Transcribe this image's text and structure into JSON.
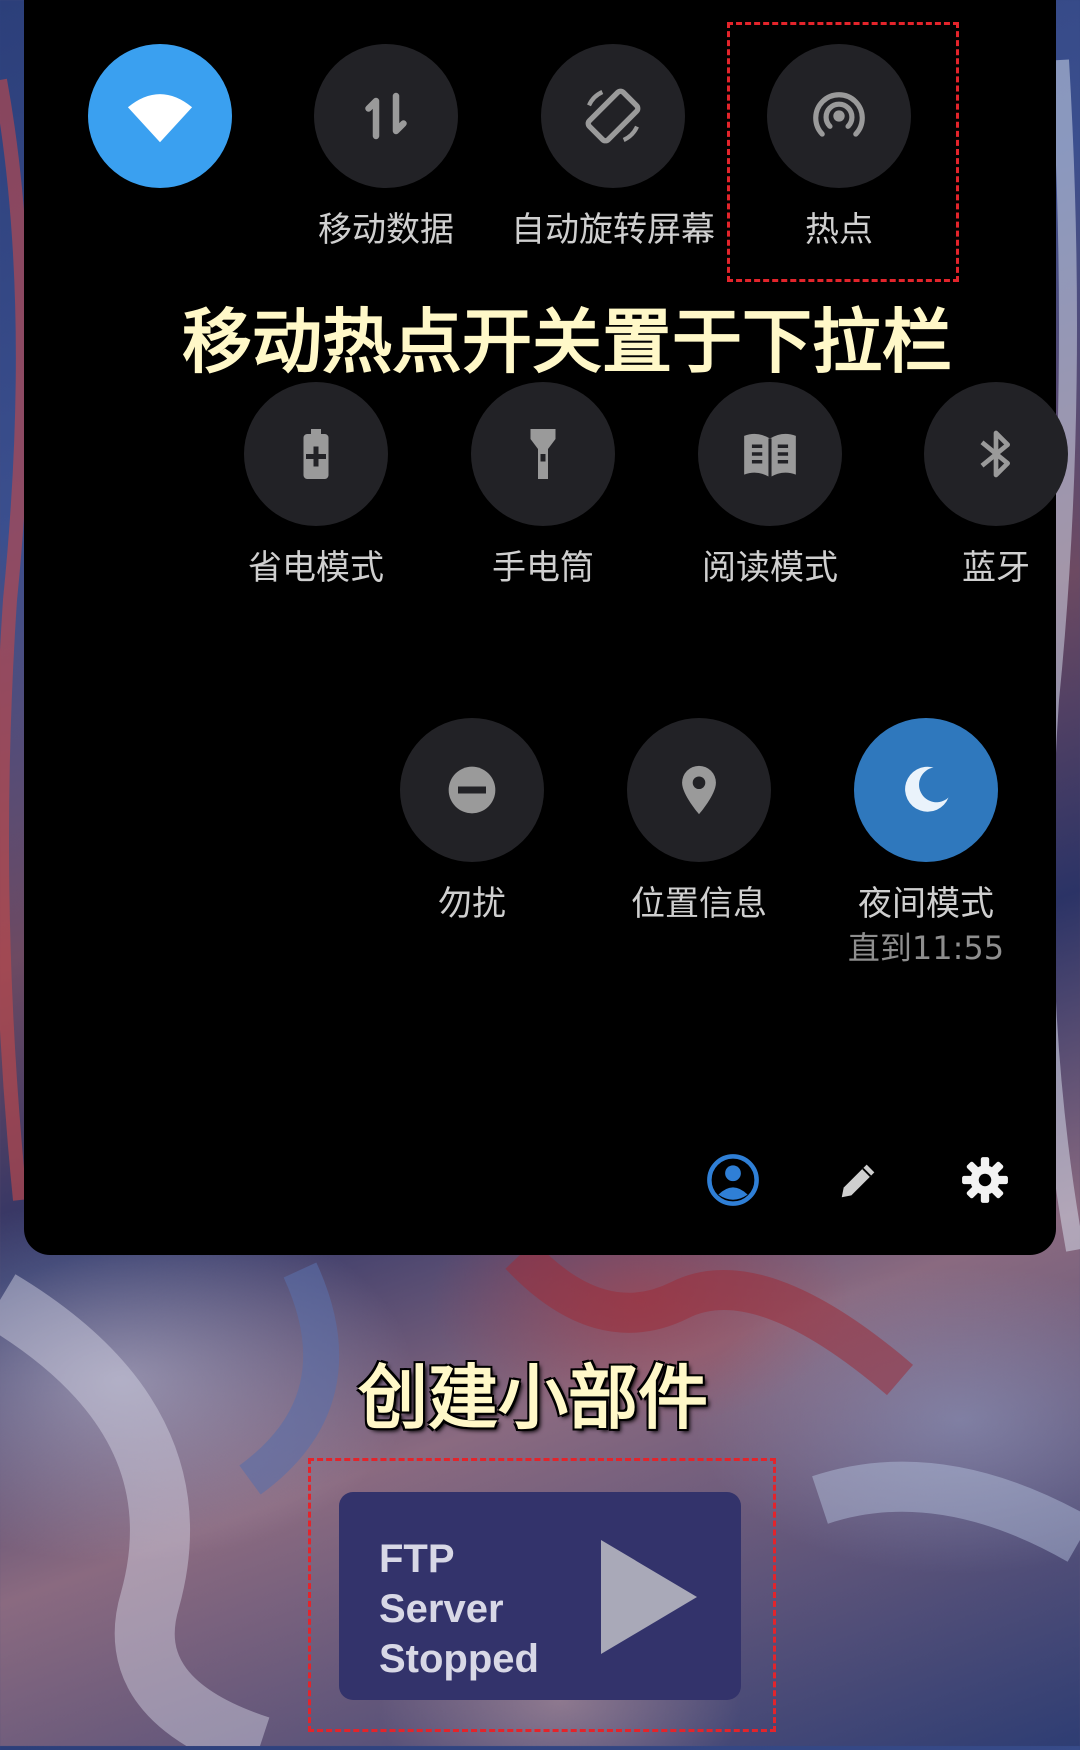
{
  "quick_settings": {
    "row1": [
      {
        "label": "",
        "icon": "wifi-icon",
        "active": true
      },
      {
        "label": "移动数据",
        "icon": "mobile-data-icon",
        "active": false
      },
      {
        "label": "自动旋转屏幕",
        "icon": "auto-rotate-icon",
        "active": false
      },
      {
        "label": "热点",
        "icon": "hotspot-icon",
        "active": false
      }
    ],
    "row2": [
      {
        "label": "省电模式",
        "icon": "battery-saver-icon",
        "active": false
      },
      {
        "label": "手电筒",
        "icon": "flashlight-icon",
        "active": false
      },
      {
        "label": "阅读模式",
        "icon": "reading-mode-icon",
        "active": false
      },
      {
        "label": "蓝牙",
        "icon": "bluetooth-icon",
        "active": false
      }
    ],
    "row3": [
      {
        "label": "勿扰",
        "icon": "do-not-disturb-icon",
        "active": false
      },
      {
        "label": "位置信息",
        "icon": "location-icon",
        "active": false
      },
      {
        "label": "夜间模式",
        "sublabel": "直到11:55",
        "icon": "night-mode-icon",
        "active": true
      }
    ],
    "footer_icons": [
      "user-account-icon",
      "edit-pencil-icon",
      "settings-gear-icon"
    ]
  },
  "annotations": {
    "hotspot_caption": "移动热点开关置于下拉栏",
    "widget_caption": "创建小部件"
  },
  "widget": {
    "line1": "FTP",
    "line2": "Server",
    "line3": "Stopped",
    "icon": "play-icon"
  },
  "colors": {
    "panel": "#000000",
    "tile_inactive": "#222226",
    "wifi_active": "#3aa0f0",
    "night_active": "#2f78bd",
    "annotation_box": "#e3242b",
    "caption_text": "#fff8c8",
    "widget_bg": "#33336b"
  }
}
